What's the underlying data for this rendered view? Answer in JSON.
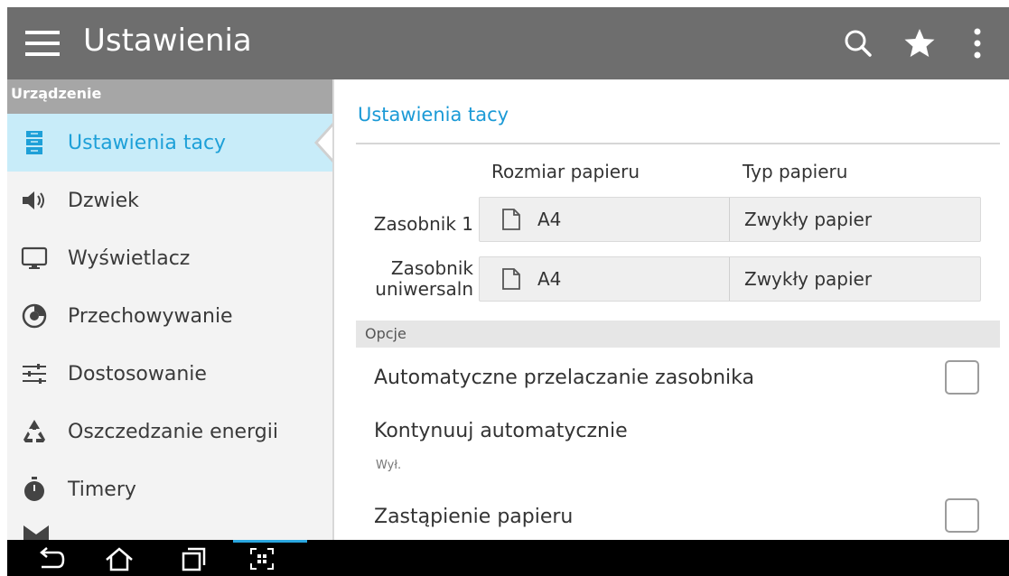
{
  "app": {
    "title": "Ustawienia"
  },
  "toolbar": {
    "icons": [
      "menu-icon",
      "search-icon",
      "star-icon",
      "more-vert-icon"
    ]
  },
  "sidebar": {
    "section": "Urządzenie",
    "items": [
      {
        "label": "Ustawienia tacy",
        "icon": "tray-icon",
        "active": true
      },
      {
        "label": "Dzwiek",
        "icon": "speaker-icon"
      },
      {
        "label": "Wyświetlacz",
        "icon": "monitor-icon"
      },
      {
        "label": "Przechowywanie",
        "icon": "storage-icon"
      },
      {
        "label": "Dostosowanie",
        "icon": "sliders-icon"
      },
      {
        "label": "Oszczedzanie energii",
        "icon": "recycle-icon"
      },
      {
        "label": "Timery",
        "icon": "timer-icon"
      }
    ]
  },
  "main": {
    "heading": "Ustawienia tacy",
    "columns": {
      "size": "Rozmiar papieru",
      "type": "Typ papieru"
    },
    "trays": [
      {
        "label": "Zasobnik 1",
        "size": "A4",
        "type": "Zwykły papier"
      },
      {
        "label_line1": "Zasobnik",
        "label_line2": "uniwersaln",
        "size": "A4",
        "type": "Zwykły papier"
      }
    ],
    "options_header": "Opcje",
    "options": [
      {
        "label": "Automatyczne przelaczanie zasobnika",
        "checked": false
      },
      {
        "label": "Kontynuuj automatycznie",
        "value": "Wył."
      },
      {
        "label": "Zastąpienie papieru",
        "checked": false
      }
    ]
  },
  "navbar": {
    "icons": [
      "back-icon",
      "home-icon",
      "recents-icon",
      "screenshot-icon"
    ]
  },
  "colors": {
    "topbar": "#6e6e6e",
    "accent": "#1ea0d8",
    "active_bg": "#c8ecf9"
  }
}
